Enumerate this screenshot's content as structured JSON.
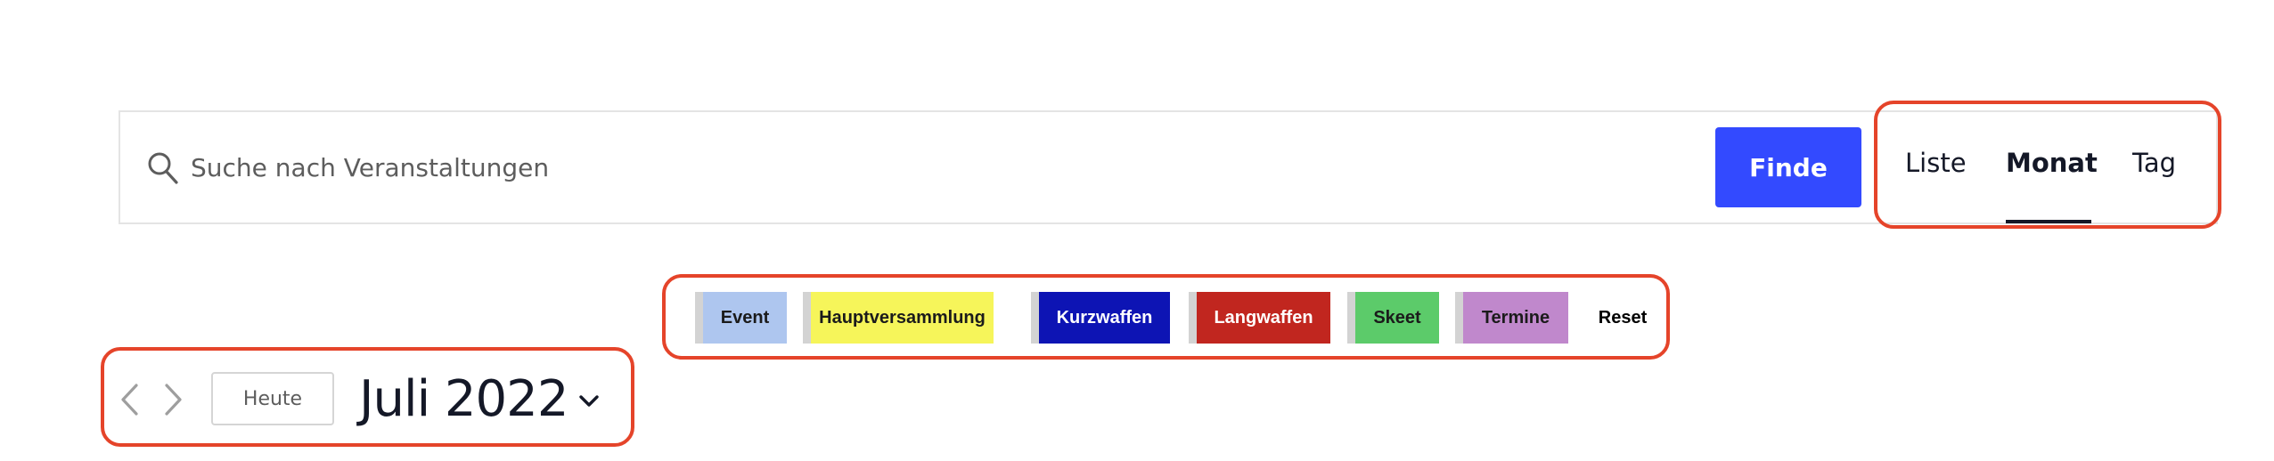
{
  "search": {
    "placeholder": "Suche nach Veranstaltungen",
    "value": "",
    "submit_label": "Finde",
    "submit_color": "#334aff",
    "icon": "search-icon"
  },
  "views": {
    "tabs": [
      {
        "label": "Liste",
        "active": false
      },
      {
        "label": "Monat",
        "active": true
      },
      {
        "label": "Tag",
        "active": false
      }
    ]
  },
  "filters": {
    "categories": [
      {
        "label": "Event",
        "bg": "#aec6ef",
        "fg": "#1b1b1b"
      },
      {
        "label": "Hauptversammlung",
        "bg": "#f6f55a",
        "fg": "#1b1b1b"
      },
      {
        "label": "Kurzwaffen",
        "bg": "#0d14b4",
        "fg": "#ffffff"
      },
      {
        "label": "Langwaffen",
        "bg": "#c1261f",
        "fg": "#ffffff"
      },
      {
        "label": "Skeet",
        "bg": "#5ccb6a",
        "fg": "#1b1b1b"
      },
      {
        "label": "Termine",
        "bg": "#c088cc",
        "fg": "#1b1b1b"
      }
    ],
    "reset_label": "Reset"
  },
  "date_nav": {
    "prev_icon": "chevron-left-icon",
    "next_icon": "chevron-right-icon",
    "today_label": "Heute",
    "current_month": "Juli 2022",
    "picker_icon": "chevron-down-icon"
  },
  "annotation_color": "#e5442a"
}
